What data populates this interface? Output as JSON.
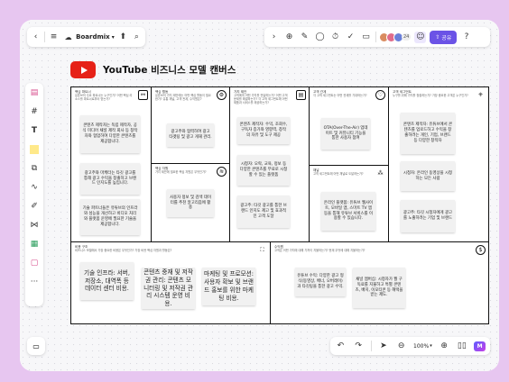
{
  "app": {
    "brand_name": "Boardmix",
    "share_label": "공유",
    "avatar_count": "24",
    "zoom_level": "100%",
    "colors": {
      "accent": "#6b53e6",
      "youtube_red": "#e62117",
      "frame_bg": "#e7c6f0"
    }
  },
  "toolbar_top_left": {
    "icons": [
      "back-icon",
      "menu-icon",
      "cloud-icon",
      "chevron-down-icon",
      "export-icon",
      "search-icon"
    ]
  },
  "toolbar_top_right": {
    "icons": [
      "chevron-right-icon",
      "add-icon",
      "pen-icon",
      "comment-icon",
      "timer-icon",
      "vote-icon",
      "present-icon",
      "help-icon"
    ]
  },
  "left_toolbar": {
    "icons": [
      "template-icon",
      "frame-icon",
      "text-icon",
      "sticky-note-icon",
      "shape-icon",
      "connector-icon",
      "pen-icon",
      "mindmap-icon",
      "table-icon",
      "document-icon",
      "more-icon"
    ]
  },
  "board": {
    "title": "YouTube 비즈니스 모델 캔버스",
    "cells": {
      "partners": {
        "title": "핵심 파트너",
        "desc": "유튜브의 주요 파트너는 누구인가? 어떤 핵심 리소스를 파트너로부터 얻는가?"
      },
      "activities": {
        "title": "핵심 활동",
        "desc": "유튜브의 가치 제안에는 어떤 핵심 활동이 필요한가? 유통 채널, 고객 관계, 수익원은?"
      },
      "resources": {
        "title": "핵심 자원",
        "desc": "가치 제안에 필요한 핵심 자원은 무엇인가?"
      },
      "value": {
        "title": "가치 제안",
        "desc": "고객에게 어떤 가치를 전달하는가? 어떤 고객 문제를 해결하는가? 각 고객 세그먼트에 어떤 제품과 서비스를 제공하는가?"
      },
      "relationships": {
        "title": "고객 관계",
        "desc": "각 고객 세그먼트는 어떤 관계를 기대하는가?"
      },
      "channels": {
        "title": "채널",
        "desc": "고객 세그먼트에 어떤 채널로 도달하는가?"
      },
      "segments": {
        "title": "고객 세그먼트",
        "desc": "누구를 위해 가치를 창출하는가? 가장 중요한 고객은 누구인가?"
      },
      "costs": {
        "title": "비용 구조",
        "desc": "비즈니스 모델에서 가장 중요한 비용은 무엇인가? 가장 비싼 핵심 자원과 활동은?"
      },
      "revenue": {
        "title": "수익원",
        "desc": "고객은 어떤 가치에 대해 기꺼이 지불하는가? 현재 무엇에 대해 지불하는가?"
      }
    },
    "notes": {
      "partners": [
        "콘텐츠 제작자는 독립 제작자, 공식 미디어 채널 제작 회사 등 창작자와 협업하여 다양한 콘텐츠를 제공합니다.",
        "광고주와 마케터는 타깃 광고를 통해 광고 수익을 창출하고 브랜드 인지도를 높입니다.",
        "기술 파트너들은 유튜브의 인프라와 성능을 개선하고 비디오 처리와 플랫폼 운영에 필요한 기술을 제공합니다."
      ],
      "activities": [
        "광고주와 협력하여 광고 타겟팅 및 광고 게재 관리."
      ],
      "resources": [
        "사용자 정보 및 검색 데이터를 추천 알고리즘에 활용"
      ],
      "value": [
        "콘텐츠 제작자: 수익, 조회수, 구독자 증가와 영향력, 창작의 자유 및 도구 제공",
        "시청자: 오락, 교육, 정보 등 다양한 콘텐츠를 무료로 시청할 수 있는 플랫폼",
        "광고주: 타깃 광고를 통한 브랜드 인지도 제고 및 효과적인 고객 도달"
      ],
      "relationships": [
        "OTA(Over-The-Air) 업데이트 및 커뮤니티 기능을 통한 사용자 참여"
      ],
      "channels": [
        "온라인 플랫폼: 유튜브 웹사이트, 모바일 앱, 스마트 TV 앱 등을 통해 유튜브 서비스를 이용할 수 있습니다."
      ],
      "segments": [
        "콘텐츠 제작자: 유튜브에서 콘텐츠를 업로드하고 수익을 창출하려는 개인, 기업, 브랜드 등 다양한 창작자",
        "시청자: 온라인 동영상을 시청하는 모든 사람",
        "광고주: 타깃 시청자에게 광고를 노출하려는 기업 및 브랜드"
      ],
      "costs": [
        "기술 인프라: 서버, 저장소, 대역폭 등 데이터 센터 비용.",
        "콘텐츠 중재 및 저작권 관리: 콘텐츠 모니터링 및 저작권 관리 시스템 운영 비용.",
        "마케팅 및 프로모션: 사용자 확보 및 브랜드 홍보를 위한 마케팅 비용."
      ],
      "revenue": [
        "유튜브 수익: 다양한 광고 형식(동영상, 배너, 오버레이)과 타깃팅을 통한 광고 수익.",
        "채널 멤버십: 시청자가 월 구독료를 지불하고 특별 콘텐츠, 배지, 이모티콘 등 혜택을 받는 제도."
      ]
    }
  }
}
